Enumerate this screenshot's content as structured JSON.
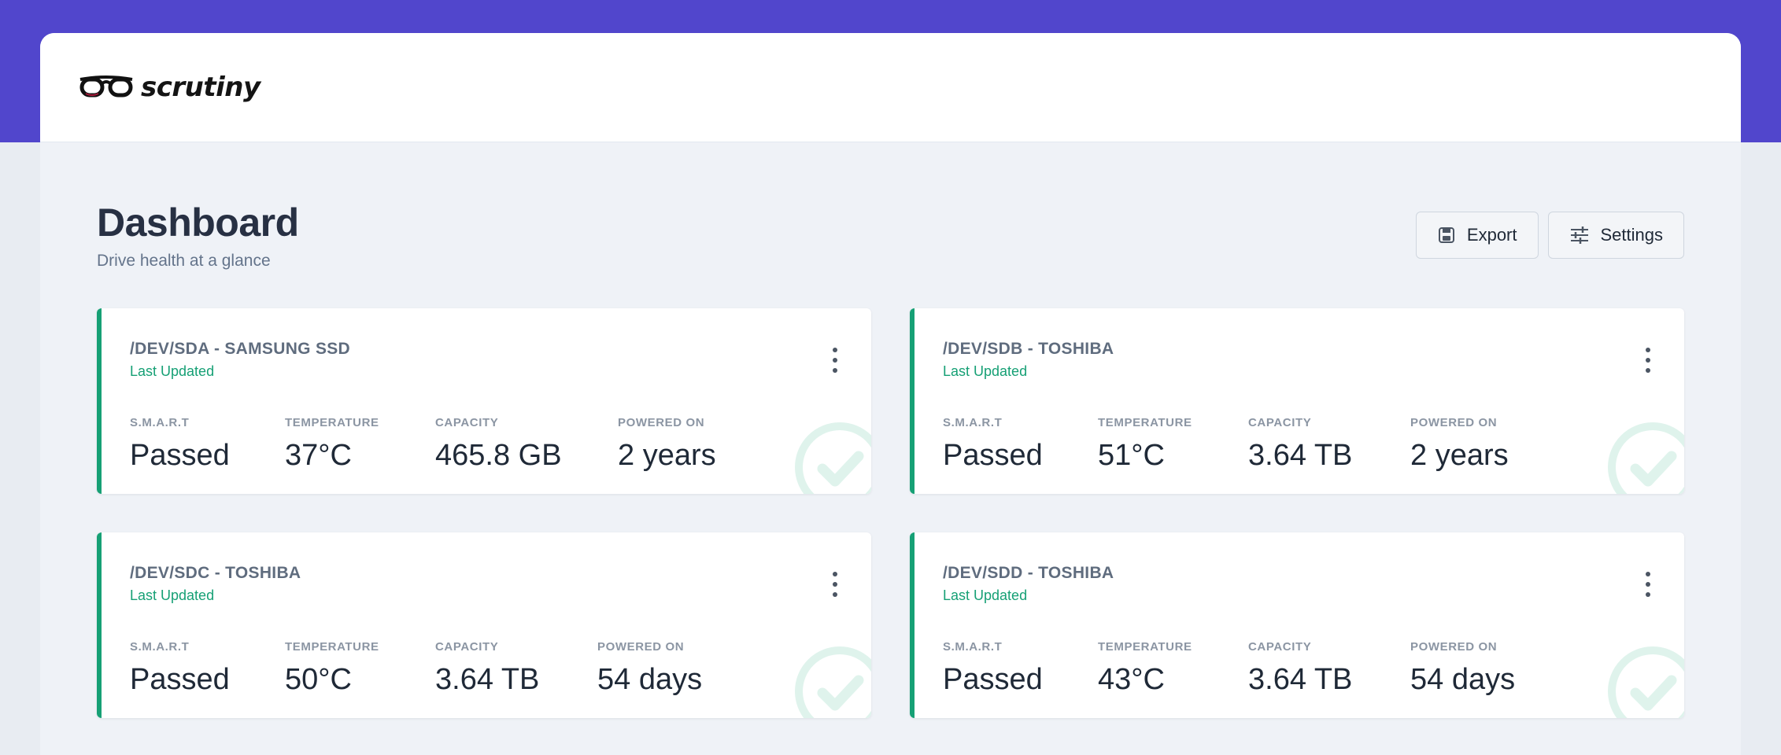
{
  "app": {
    "logo_text": "scrutiny"
  },
  "page": {
    "title": "Dashboard",
    "subtitle": "Drive health at a glance"
  },
  "actions": {
    "export_label": "Export",
    "settings_label": "Settings"
  },
  "colors": {
    "brand": "#5146cc",
    "passed": "#16a075"
  },
  "metric_labels": {
    "smart": "S.M.A.R.T",
    "temperature": "TEMPERATURE",
    "capacity": "CAPACITY",
    "powered_on": "POWERED ON"
  },
  "drives": [
    {
      "title": "/DEV/SDA - SAMSUNG SSD",
      "updated": "Last Updated",
      "smart": "Passed",
      "temperature": "37°C",
      "capacity": "465.8 GB",
      "powered_on": "2 years",
      "status_icon": "check-circle-icon"
    },
    {
      "title": "/DEV/SDB - TOSHIBA",
      "updated": "Last Updated",
      "smart": "Passed",
      "temperature": "51°C",
      "capacity": "3.64 TB",
      "powered_on": "2 years",
      "status_icon": "check-circle-icon"
    },
    {
      "title": "/DEV/SDC - TOSHIBA",
      "updated": "Last Updated",
      "smart": "Passed",
      "temperature": "50°C",
      "capacity": "3.64 TB",
      "powered_on": "54 days",
      "status_icon": "check-circle-icon"
    },
    {
      "title": "/DEV/SDD - TOSHIBA",
      "updated": "Last Updated",
      "smart": "Passed",
      "temperature": "43°C",
      "capacity": "3.64 TB",
      "powered_on": "54 days",
      "status_icon": "check-circle-icon"
    }
  ]
}
